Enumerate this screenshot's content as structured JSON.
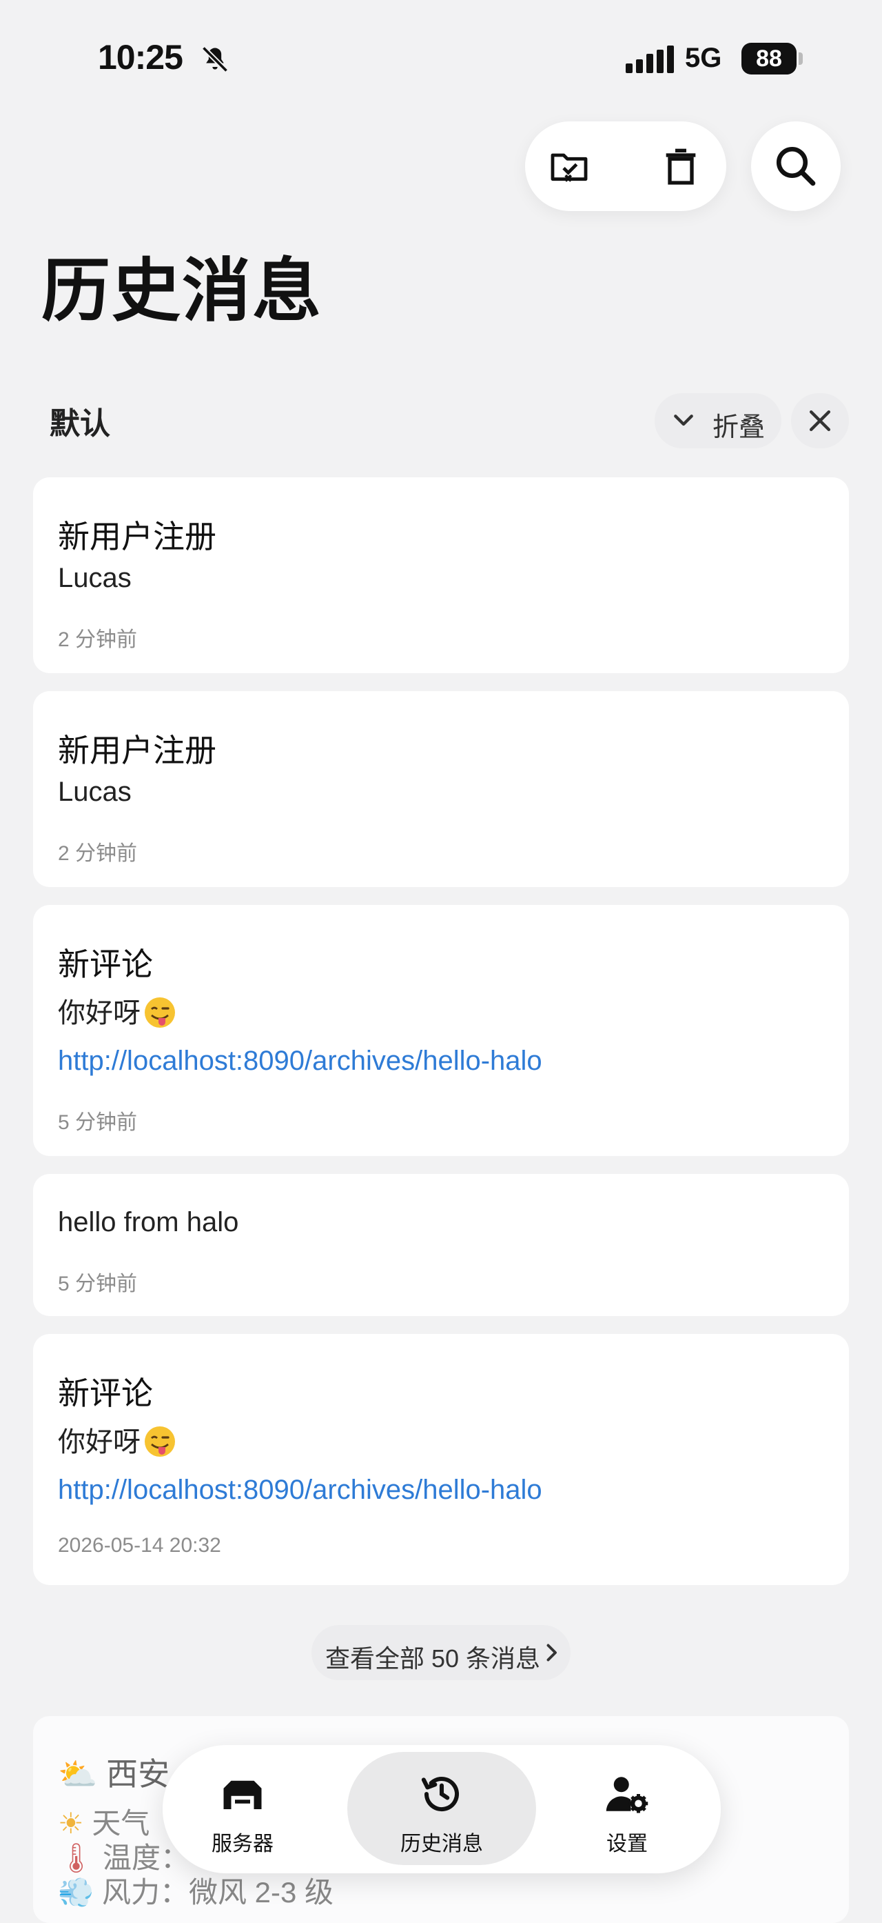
{
  "status_bar": {
    "time": "10:25",
    "network": "5G",
    "battery": "88"
  },
  "page": {
    "title": "历史消息"
  },
  "group": {
    "name": "默认",
    "collapse_label": "折叠"
  },
  "messages": [
    {
      "title": "新用户注册",
      "body": "Lucas",
      "link": "",
      "time": "2 分钟前"
    },
    {
      "title": "新用户注册",
      "body": "Lucas",
      "link": "",
      "time": "2 分钟前"
    },
    {
      "title": "新评论",
      "body": "你好呀",
      "link": "http://localhost:8090/archives/hello-halo",
      "time": "5 分钟前"
    },
    {
      "title": "",
      "body": "hello from halo",
      "link": "",
      "time": "5 分钟前"
    },
    {
      "title": "新评论",
      "body": "你好呀",
      "link": "http://localhost:8090/archives/hello-halo",
      "time": "2026-05-14 20:32"
    }
  ],
  "view_all_label": "查看全部 50 条消息",
  "weather_card": {
    "title": "西安",
    "weather_label": "天气",
    "temp_label": "温度：",
    "wind": "风力：微风 2-3 级"
  },
  "tabs": [
    {
      "label": "服务器",
      "icon": "server-icon"
    },
    {
      "label": "历史消息",
      "icon": "history-icon"
    },
    {
      "label": "设置",
      "icon": "user-settings-icon"
    }
  ],
  "colors": {
    "link": "#2e7bd6",
    "background": "#f2f2f3",
    "card": "#ffffff"
  }
}
